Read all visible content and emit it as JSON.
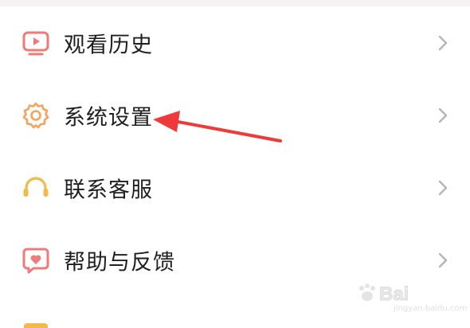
{
  "menu": {
    "items": [
      {
        "label": "观看历史",
        "icon": "play-screen-icon",
        "icon_color": "#f07a7a"
      },
      {
        "label": "系统设置",
        "icon": "gear-icon",
        "icon_color": "#f5a25d"
      },
      {
        "label": "联系客服",
        "icon": "headset-icon",
        "icon_color": "#f3b94a"
      },
      {
        "label": "帮助与反馈",
        "icon": "heart-chat-icon",
        "icon_color": "#f07a7a"
      }
    ]
  },
  "annotation": {
    "arrow_color": "#f03a3a"
  },
  "watermark": {
    "text": "Bai",
    "sub": "jingyan.baidu.com"
  },
  "chevron_color": "#b5b5b5"
}
